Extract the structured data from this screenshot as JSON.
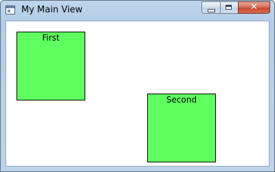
{
  "window": {
    "title": "My Main View",
    "icon": "application-window-icon",
    "controls": {
      "minimize_icon": "minimize-icon",
      "maximize_icon": "maximize-icon",
      "close_icon": "close-icon",
      "close_glyph": "✕"
    }
  },
  "canvas": {
    "background": "#ffffff",
    "boxes": [
      {
        "label": "First",
        "fill": "#5fff5f",
        "border": "#000000"
      },
      {
        "label": "Second",
        "fill": "#5fff5f",
        "border": "#000000"
      }
    ]
  }
}
